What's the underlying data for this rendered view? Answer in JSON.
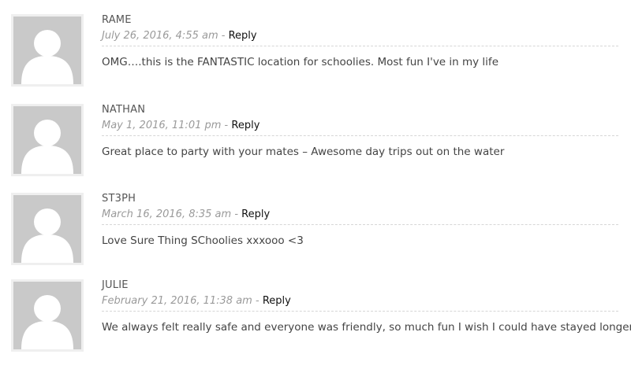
{
  "comments": [
    {
      "author": "RAME",
      "date": "July 26, 2016, 4:55 am",
      "separator": "-",
      "reply_label": "Reply",
      "text": "OMG….this is the FANTASTIC location for schoolies. Most fun I've in my life"
    },
    {
      "author": "NATHAN",
      "date": "May 1, 2016, 11:01 pm",
      "separator": "-",
      "reply_label": "Reply",
      "text": "Great place to party with your mates – Awesome day trips out on the water"
    },
    {
      "author": "ST3PH",
      "date": "March 16, 2016, 8:35 am",
      "separator": "-",
      "reply_label": "Reply",
      "text": "Love Sure Thing SChoolies xxxooo <3"
    },
    {
      "author": "JULIE",
      "date": "February 21, 2016, 11:38 am",
      "separator": "-",
      "reply_label": "Reply",
      "text": "We always felt really safe and everyone was friendly, so much fun I wish I could have stayed longer ?"
    }
  ],
  "colors": {
    "avatar_bg": "#c9c9c9",
    "avatar_silhouette": "#ffffff",
    "meta_text": "#9a9a9a",
    "reply_link": "#111111"
  },
  "icons": {
    "avatar": "default-user-avatar-icon"
  }
}
